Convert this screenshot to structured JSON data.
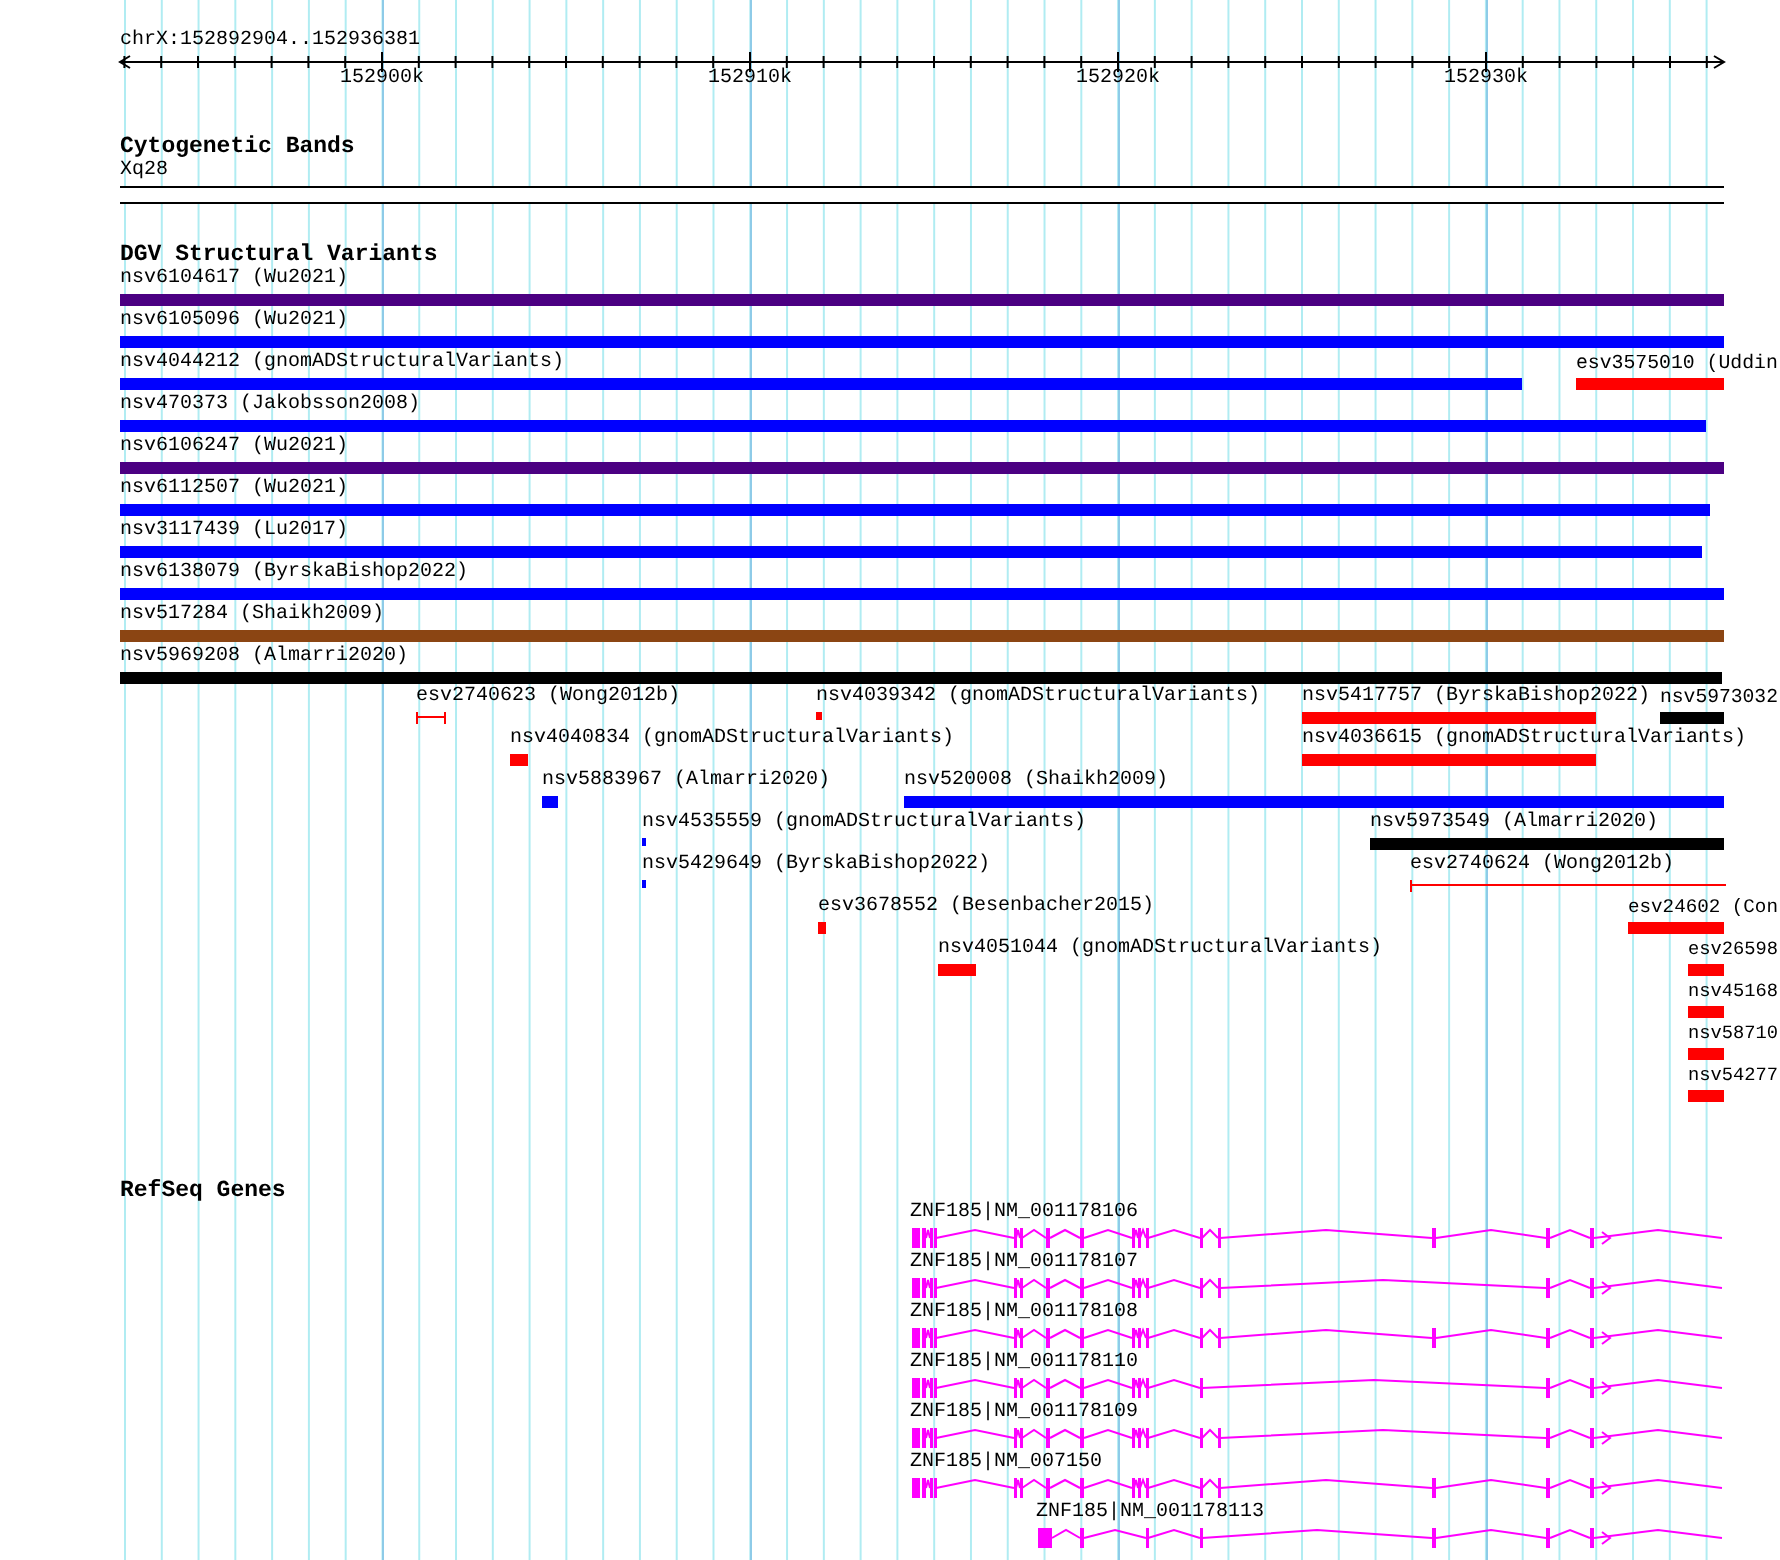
{
  "ruler": {
    "location": "chrX:152892904..152936381",
    "tick_labels": [
      "152900k",
      "152910k",
      "152920k",
      "152930k"
    ]
  },
  "tracks": [
    {
      "kind": "cytoband",
      "title": "Cytogenetic Bands",
      "band": "Xq28"
    },
    {
      "kind": "variants",
      "title": "DGV Structural Variants",
      "features": [
        {
          "label": "nsv6104617 (Wu2021)",
          "color": "#4b0082",
          "kind": "bar"
        },
        {
          "label": "nsv6105096 (Wu2021)",
          "color": "#0000ff",
          "kind": "bar"
        },
        {
          "label": "nsv4044212 (gnomADStructuralVariants)",
          "color": "#0000ff",
          "kind": "bar"
        },
        {
          "label": "esv3575010 (Uddin",
          "color": "#ff0000",
          "kind": "bar"
        },
        {
          "label": "nsv470373 (Jakobsson2008)",
          "color": "#0000ff",
          "kind": "bar"
        },
        {
          "label": "nsv6106247 (Wu2021)",
          "color": "#4b0082",
          "kind": "bar"
        },
        {
          "label": "nsv6112507 (Wu2021)",
          "color": "#0000ff",
          "kind": "bar"
        },
        {
          "label": "nsv3117439 (Lu2017)",
          "color": "#0000ff",
          "kind": "bar"
        },
        {
          "label": "nsv6138079 (ByrskaBishop2022)",
          "color": "#0000ff",
          "kind": "bar"
        },
        {
          "label": "nsv517284 (Shaikh2009)",
          "color": "#8b4513",
          "kind": "bar"
        },
        {
          "label": "nsv5969208 (Almarri2020)",
          "color": "#000000",
          "kind": "bar"
        },
        {
          "label": "esv2740623 (Wong2012b)",
          "color": "#ff0000",
          "kind": "line"
        },
        {
          "label": "nsv4039342 (gnomADStructuralVariants)",
          "color": "#ff0000",
          "kind": "bar"
        },
        {
          "label": "nsv5417757 (ByrskaBishop2022)",
          "color": "#ff0000",
          "kind": "bar"
        },
        {
          "label": "nsv5973032",
          "color": "#000000",
          "kind": "bar"
        },
        {
          "label": "nsv4040834 (gnomADStructuralVariants)",
          "color": "#ff0000",
          "kind": "bar"
        },
        {
          "label": "nsv4036615 (gnomADStructuralVariants)",
          "color": "#ff0000",
          "kind": "bar"
        },
        {
          "label": "nsv5883967 (Almarri2020)",
          "color": "#0000ff",
          "kind": "bar"
        },
        {
          "label": "nsv520008 (Shaikh2009)",
          "color": "#0000ff",
          "kind": "bar"
        },
        {
          "label": "nsv4535559 (gnomADStructuralVariants)",
          "color": "#0000ff",
          "kind": "bar"
        },
        {
          "label": "nsv5973549 (Almarri2020)",
          "color": "#000000",
          "kind": "bar"
        },
        {
          "label": "nsv5429649 (ByrskaBishop2022)",
          "color": "#0000ff",
          "kind": "bar"
        },
        {
          "label": "esv2740624 (Wong2012b)",
          "color": "#ff0000",
          "kind": "line"
        },
        {
          "label": "esv3678552 (Besenbacher2015)",
          "color": "#ff0000",
          "kind": "bar"
        },
        {
          "label": "esv24602 (Con",
          "color": "#ff0000",
          "kind": "bar"
        },
        {
          "label": "nsv4051044 (gnomADStructuralVariants)",
          "color": "#ff0000",
          "kind": "bar"
        },
        {
          "label": "esv26598",
          "color": "#ff0000",
          "kind": "bar"
        },
        {
          "label": "nsv45168",
          "color": "#ff0000",
          "kind": "bar"
        },
        {
          "label": "nsv58710",
          "color": "#ff0000",
          "kind": "bar"
        },
        {
          "label": "nsv54277",
          "color": "#ff0000",
          "kind": "bar"
        }
      ]
    },
    {
      "kind": "genes",
      "title": "RefSeq Genes",
      "transcripts": [
        {
          "label": "ZNF185|NM_001178106"
        },
        {
          "label": "ZNF185|NM_001178107"
        },
        {
          "label": "ZNF185|NM_001178108"
        },
        {
          "label": "ZNF185|NM_001178110"
        },
        {
          "label": "ZNF185|NM_001178109"
        },
        {
          "label": "ZNF185|NM_007150"
        },
        {
          "label": "ZNF185|NM_001178113"
        }
      ]
    }
  ]
}
